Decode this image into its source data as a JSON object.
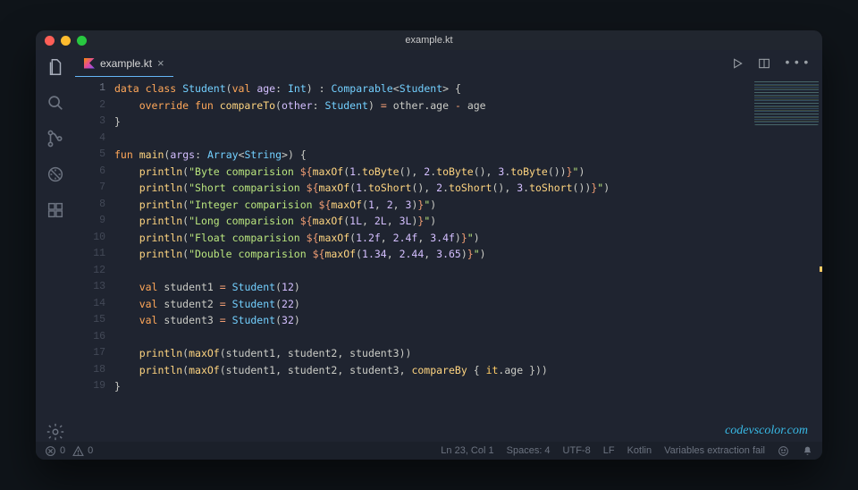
{
  "window": {
    "title": "example.kt"
  },
  "tab": {
    "filename": "example.kt"
  },
  "code": {
    "lines": 19
  },
  "status": {
    "errors": "0",
    "warnings": "0",
    "cursor": "Ln 23, Col 1",
    "spaces": "Spaces: 4",
    "encoding": "UTF-8",
    "eol": "LF",
    "language": "Kotlin",
    "message": "Variables extraction fail"
  },
  "watermark": "codevscolor.com",
  "source": {
    "class_decl": "data class Student(val age: Int) : Comparable<Student> {",
    "compareTo": "override fun compareTo(other: Student) = other.age - age",
    "main_sig": "fun main(args: Array<String>) {",
    "prints": [
      "println(\"Byte comparision ${maxOf(1.toByte(), 2.toByte(), 3.toByte())}\")",
      "println(\"Short comparision ${maxOf(1.toShort(), 2.toShort(), 3.toShort())}\")",
      "println(\"Integer comparision ${maxOf(1, 2, 3)}\")",
      "println(\"Long comparision ${maxOf(1L, 2L, 3L)}\")",
      "println(\"Float comparision ${maxOf(1.2f, 2.4f, 3.4f)}\")",
      "println(\"Double comparision ${maxOf(1.34, 2.44, 3.65)}\")"
    ],
    "students": [
      "val student1 = Student(12)",
      "val student2 = Student(22)",
      "val student3 = Student(32)"
    ],
    "final_prints": [
      "println(maxOf(student1, student2, student3))",
      "println(maxOf(student1, student2, student3, compareBy { it.age }))"
    ]
  }
}
